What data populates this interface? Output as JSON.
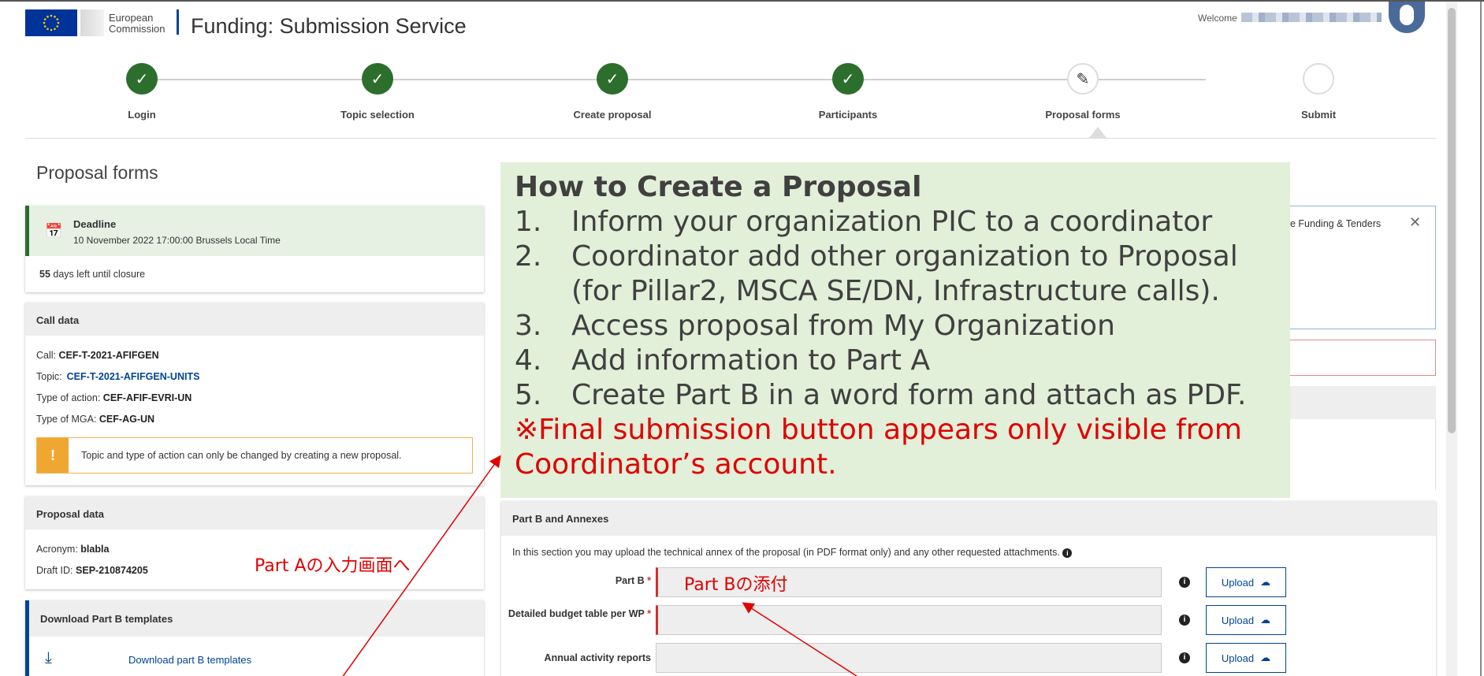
{
  "header": {
    "logo_line1": "European",
    "logo_line2": "Commission",
    "app_title": "Funding: Submission Service",
    "welcome": "Welcome"
  },
  "stepper": {
    "steps": [
      {
        "label": "Login",
        "state": "done"
      },
      {
        "label": "Topic selection",
        "state": "done"
      },
      {
        "label": "Create proposal",
        "state": "done"
      },
      {
        "label": "Participants",
        "state": "done"
      },
      {
        "label": "Proposal forms",
        "state": "current"
      },
      {
        "label": "Submit",
        "state": "todo"
      }
    ]
  },
  "page": {
    "heading": "Proposal forms"
  },
  "deadline": {
    "title": "Deadline",
    "date": "10 November 2022 17:00:00 Brussels Local Time",
    "days_left": "55",
    "days_left_suffix": " days left until closure"
  },
  "call_data": {
    "title": "Call data",
    "call_label": "Call:",
    "call_value": "CEF-T-2021-AFIFGEN",
    "topic_label": "Topic:",
    "topic_value": "CEF-T-2021-AFIFGEN-UNITS",
    "action_label": "Type of action:",
    "action_value": "CEF-AFIF-EVRI-UN",
    "mga_label": "Type of MGA:",
    "mga_value": "CEF-AG-UN",
    "warning": "Topic and type of action can only be changed by creating a new proposal."
  },
  "proposal_data": {
    "title": "Proposal data",
    "acronym_label": "Acronym:",
    "acronym_value": "blabla",
    "draft_label": "Draft ID:",
    "draft_value": "SEP-210874205"
  },
  "download": {
    "title": "Download Part B templates",
    "link": "Download part B templates"
  },
  "info_banner": {
    "text_partial": "e Funding & Tenders"
  },
  "overlay": {
    "title": "How to Create a Proposal",
    "items": [
      {
        "num": "1.",
        "text": "Inform your organization PIC to a coordinator"
      },
      {
        "num": "2.",
        "text": "Coordinator add other organization to Proposal (for Pillar2, MSCA SE/DN, Infrastructure calls)."
      },
      {
        "num": "3.",
        "text": "Access proposal from My Organization"
      },
      {
        "num": "4.",
        "text": "Add information to Part A"
      },
      {
        "num": "5.",
        "text": "Create Part B in a word form and attach as PDF."
      }
    ],
    "note": "※Final submission button appears only visible from Coordinator’s account."
  },
  "part_b": {
    "title": "Part B and Annexes",
    "description": "In this section you may upload the technical annex of the proposal (in PDF format only) and any other requested attachments.",
    "rows": [
      {
        "label": "Part B",
        "required": true,
        "upload": "Upload"
      },
      {
        "label": "Detailed budget table per WP",
        "required": true,
        "upload": "Upload"
      },
      {
        "label": "Annual activity reports",
        "required": false,
        "upload": "Upload"
      }
    ]
  },
  "annotations": {
    "part_a": "Part Aの入力画面へ",
    "part_b": "Part Bの添付"
  },
  "colors": {
    "done_green": "#2c6e2c",
    "link_blue": "#004494",
    "overlay_bg": "#e2efd9",
    "annotation_red": "#e00000"
  }
}
